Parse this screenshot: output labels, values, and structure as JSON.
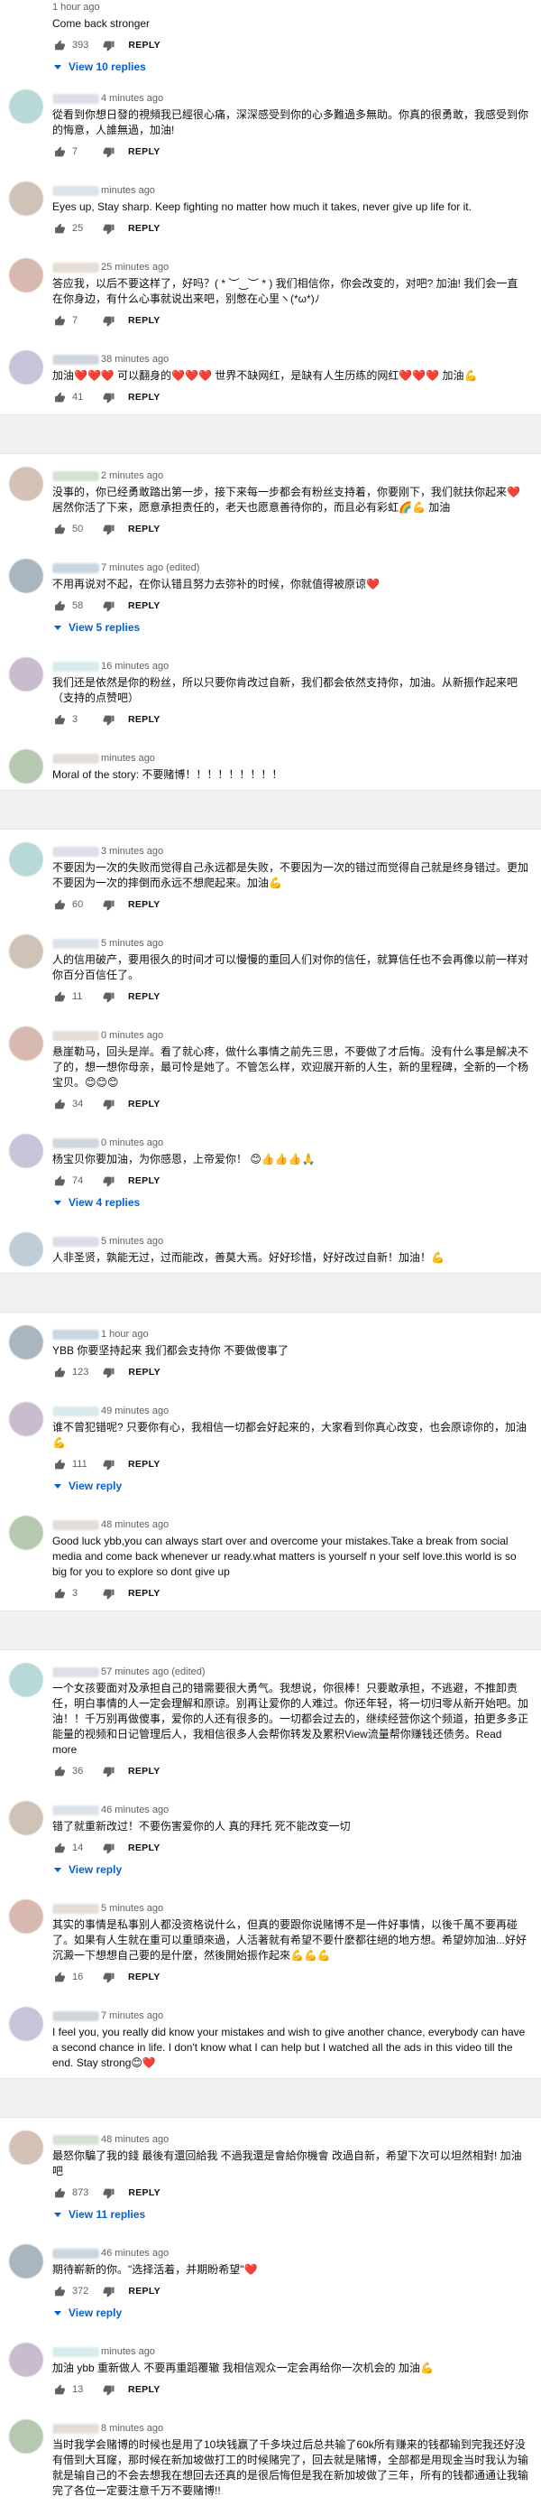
{
  "ui": {
    "reply_label": "REPLY",
    "icons": {
      "like": "thumbs-up-icon",
      "dislike": "thumbs-down-icon",
      "expand": "caret-down-icon"
    },
    "colors": {
      "link": "#065fd4",
      "meta": "#606060",
      "text": "#0f0f0f",
      "separator": "#f1f1f1"
    }
  },
  "comments": [
    {
      "time": "1 hour ago",
      "text": "Come back stronger",
      "likes": "393",
      "replies": "View 10 replies"
    },
    {
      "time": "4 minutes ago",
      "text": "從看到你想日發的視頻我已經很心痛，深深感受到你的心多難過多無助。你真的很勇敢，我感受到你的悔意，人誰無過，加油!",
      "likes": "7",
      "replies": ""
    },
    {
      "time": "minutes ago",
      "text": "Eyes up, Stay sharp. Keep fighting no matter how much it takes, never give up life for it.",
      "likes": "25",
      "replies": ""
    },
    {
      "time": "25 minutes ago",
      "text": "答应我，以后不要这样了，好吗？( * ︶‿︶ * ) 我们相信你，你会改变的，对吧? 加油! 我们会一直在你身边，有什么心事就说出来吧，别憋在心里ヽ(*ω*)ﾉ",
      "likes": "7",
      "replies": ""
    },
    {
      "time": "38 minutes ago",
      "text": "加油❤️❤️❤️ 可以翻身的❤️❤️❤️ 世界不缺网红，是缺有人生历练的网红❤️❤️❤️ 加油💪",
      "likes": "41",
      "replies": ""
    },
    {
      "sep": true
    },
    {
      "time": "2 minutes ago",
      "text": "没事的，你已经勇敢踏出第一步，接下来每一步都会有粉丝支持着，你要刚下，我们就扶你起来❤️ 居然你活了下来，愿意承担责任的，老天也愿意善待你的，而且必有彩虹🌈💪 加油",
      "likes": "50",
      "replies": ""
    },
    {
      "time": "7 minutes ago (edited)",
      "text": "不用再说对不起，在你认错且努力去弥补的时候，你就值得被原谅❤️",
      "likes": "58",
      "replies": "View 5 replies"
    },
    {
      "time": "16 minutes ago",
      "text": "我们还是依然是你的粉丝，所以只要你肯改过自新，我们都会依然支持你，加油。从新振作起来吧（支持的点赞吧）",
      "likes": "3",
      "replies": ""
    },
    {
      "time": "minutes ago",
      "text": "Moral of the story: 不要赌博！！！！！！！！！",
      "likes": "",
      "replies": "",
      "noactions": true
    },
    {
      "sep": true
    },
    {
      "time": "3 minutes ago",
      "text": "不要因为一次的失败而觉得自己永远都是失败，不要因为一次的错过而觉得自己就是终身错过。更加不要因为一次的摔倒而永远不想爬起来。加油💪",
      "likes": "60",
      "replies": ""
    },
    {
      "time": "5 minutes ago",
      "text": "人的信用破产，要用很久的时间才可以慢慢的重回人们对你的信任，就算信任也不会再像以前一样对你百分百信任了。",
      "likes": "11",
      "replies": ""
    },
    {
      "time": "0 minutes ago",
      "text": "悬崖勒马，回头是岸。看了就心疼，做什么事情之前先三思，不要做了才后悔。没有什么事是解决不了的，想一想你母亲，最可怜是她了。不管怎么样，欢迎展开新的人生，新的里程碑，全新的一个杨宝贝。😊😊😊",
      "likes": "34",
      "replies": ""
    },
    {
      "time": "0 minutes ago",
      "text": "杨宝贝你要加油，为你感恩，上帝爱你！ 😊👍👍👍🙏",
      "likes": "74",
      "replies": "View 4 replies"
    },
    {
      "time": "5 minutes ago",
      "text": "人非圣贤，孰能无过，过而能改，善莫大焉。好好珍惜，好好改过自新！加油！💪",
      "likes": "",
      "replies": "",
      "noactions": true
    },
    {
      "sep": true
    },
    {
      "time": "1 hour ago",
      "text": "YBB 你要坚持起来 我们都会支持你 不要做傻事了",
      "likes": "123",
      "replies": ""
    },
    {
      "time": "49 minutes ago",
      "text": "谁不曾犯错呢? 只要你有心，我相信一切都会好起来的，大家看到你真心改变，也会原谅你的，加油💪",
      "likes": "111",
      "replies": "View reply"
    },
    {
      "time": "48 minutes ago",
      "text": "Good luck ybb,you can always start over and overcome your mistakes.Take a break from social media and come back whenever ur ready.what matters is yourself n your self love.this world is so big for you to explore so dont give up",
      "likes": "3",
      "replies": ""
    },
    {
      "sep": true
    },
    {
      "time": "57 minutes ago (edited)",
      "text": "一个女孩要面对及承担自己的错需要很大勇气。我想说，你很棒！只要敢承担，不逃避，不推卸责任，明白事情的人一定会理解和原谅。别再让爱你的人难过。你还年轻，将一切归零从新开始吧。加油！！千万别再做傻事，爱你的人还有很多的。一切都会过去的，继续经营你这个频道，拍更多多正能量的视频和日记管理后人，我相信很多人会帮你转发及累积View流量帮你赚钱还债务。Read more",
      "likes": "36",
      "replies": ""
    },
    {
      "time": "46 minutes ago",
      "text": "错了就重新改过！不要伤害爱你的人 真的拜托 死不能改变一切",
      "likes": "14",
      "replies": "View reply"
    },
    {
      "time": "5 minutes ago",
      "text": "其实的事情是私事别人都没资格说什么，但真的要跟你说赌博不是一件好事情，以後千萬不要再碰了。如果有人生就在重可以重頭來過，人活著就有希望不要什麼都往絕的地方想。希望妳加油...好好沉澱一下想想自己要的是什麼，然後開始振作起來💪💪💪",
      "likes": "16",
      "replies": ""
    },
    {
      "time": "7 minutes ago",
      "text": "I feel you, you really did know your mistakes and wish to give another chance, everybody can have a second chance in life. I don't know what I can help but I watched all the ads in this video till the end. Stay strong😊❤️",
      "likes": "",
      "replies": "",
      "noactions": true
    },
    {
      "sep": true
    },
    {
      "time": "48 minutes ago",
      "text": "最怒你騙了我的錢 最後有還回給我 不過我還是會給你機會 改過自新，希望下次可以坦然相對! 加油吧",
      "likes": "873",
      "replies": "View 11 replies"
    },
    {
      "time": "46 minutes ago",
      "text": "期待嶄新的你。\"选择活着，并期盼希望\"❤️",
      "likes": "372",
      "replies": "View reply"
    },
    {
      "time": "minutes ago",
      "text": "加油 ybb 重新做人 不要再重蹈覆辙 我相信观众一定会再给你一次机会的 加油💪",
      "likes": "13",
      "replies": ""
    },
    {
      "time": "8 minutes ago",
      "text": "当时我学会赌博的时候也是用了10块钱赢了千多块过后总共输了60k所有赚来的钱都输到完我还好没有借到大耳窿，那时候在新加坡做打工的时候赌完了，回去就是赌博，全部都是用现金当时我认为输就是输自己的不会去想我在想回去还真的是很后悔但是我在新加坡做了三年，所有的钱都通通让我输完了各位一定要注意千万不要赌博!!",
      "likes": "",
      "replies": "",
      "noactions": true
    }
  ]
}
